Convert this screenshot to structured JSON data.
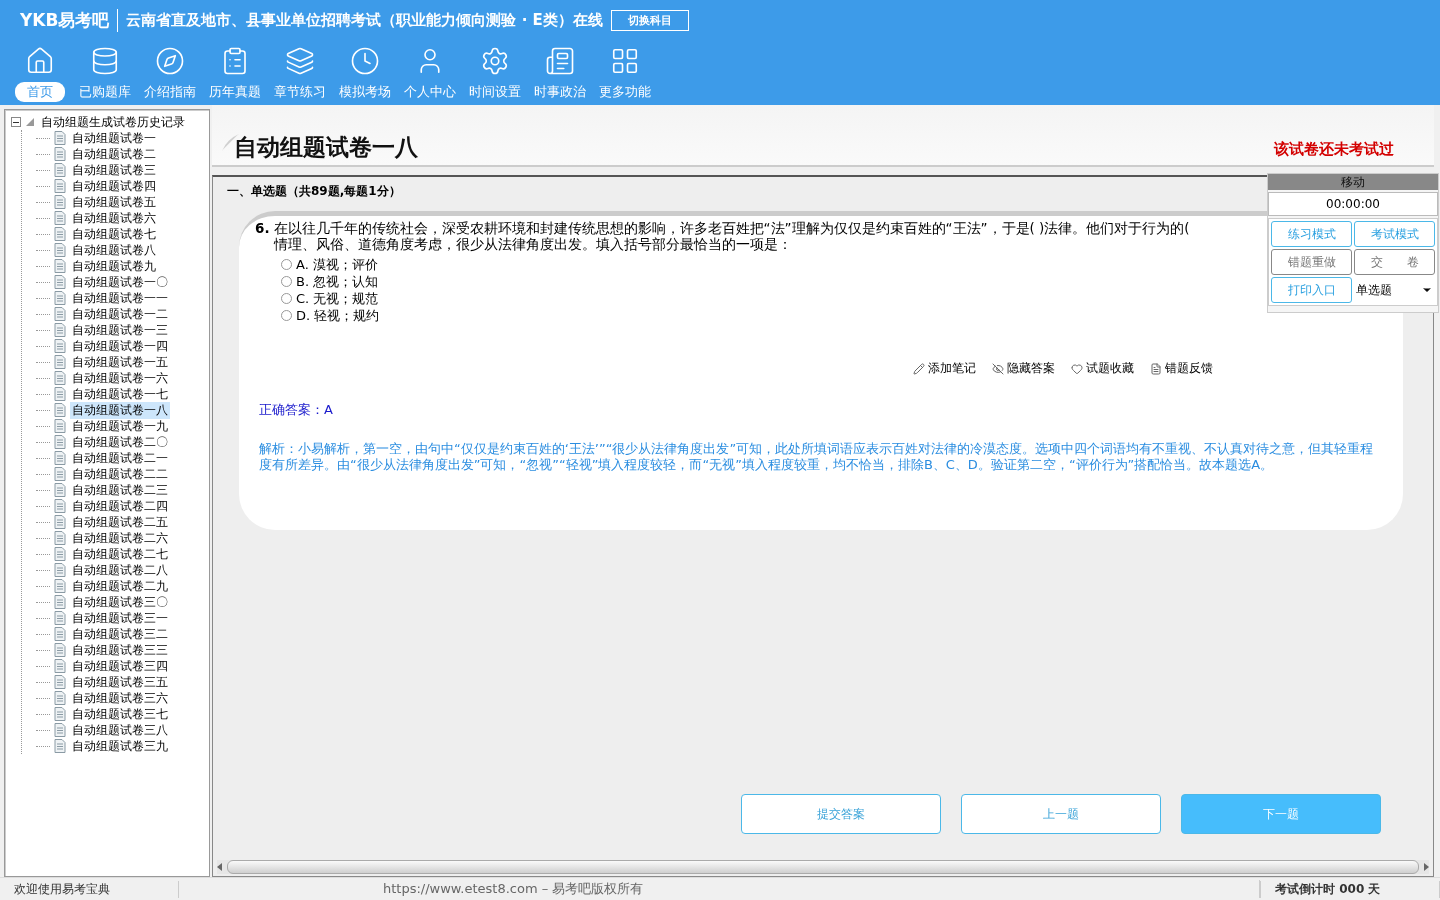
{
  "app": {
    "logo": "YKB易考吧",
    "title": "云南省直及地市、县事业单位招聘考试（职业能力倾向测验 · E类）在线",
    "switch_button": "切换科目"
  },
  "nav": [
    {
      "label": "首页",
      "selected": true
    },
    {
      "label": "已购题库",
      "selected": false
    },
    {
      "label": "介绍指南",
      "selected": false
    },
    {
      "label": "历年真题",
      "selected": false
    },
    {
      "label": "章节练习",
      "selected": false
    },
    {
      "label": "模拟考场",
      "selected": false
    },
    {
      "label": "个人中心",
      "selected": false
    },
    {
      "label": "时间设置",
      "selected": false
    },
    {
      "label": "时事政治",
      "selected": false
    },
    {
      "label": "更多功能",
      "selected": false
    }
  ],
  "tree": {
    "root": "自动组题生成试卷历史记录",
    "expanded": true,
    "children": [
      {
        "label": "自动组题试卷一",
        "selected": false
      },
      {
        "label": "自动组题试卷二",
        "selected": false
      },
      {
        "label": "自动组题试卷三",
        "selected": false
      },
      {
        "label": "自动组题试卷四",
        "selected": false
      },
      {
        "label": "自动组题试卷五",
        "selected": false
      },
      {
        "label": "自动组题试卷六",
        "selected": false
      },
      {
        "label": "自动组题试卷七",
        "selected": false
      },
      {
        "label": "自动组题试卷八",
        "selected": false
      },
      {
        "label": "自动组题试卷九",
        "selected": false
      },
      {
        "label": "自动组题试卷一〇",
        "selected": false
      },
      {
        "label": "自动组题试卷一一",
        "selected": false
      },
      {
        "label": "自动组题试卷一二",
        "selected": false
      },
      {
        "label": "自动组题试卷一三",
        "selected": false
      },
      {
        "label": "自动组题试卷一四",
        "selected": false
      },
      {
        "label": "自动组题试卷一五",
        "selected": false
      },
      {
        "label": "自动组题试卷一六",
        "selected": false
      },
      {
        "label": "自动组题试卷一七",
        "selected": false
      },
      {
        "label": "自动组题试卷一八",
        "selected": true
      },
      {
        "label": "自动组题试卷一九",
        "selected": false
      },
      {
        "label": "自动组题试卷二〇",
        "selected": false
      },
      {
        "label": "自动组题试卷二一",
        "selected": false
      },
      {
        "label": "自动组题试卷二二",
        "selected": false
      },
      {
        "label": "自动组题试卷二三",
        "selected": false
      },
      {
        "label": "自动组题试卷二四",
        "selected": false
      },
      {
        "label": "自动组题试卷二五",
        "selected": false
      },
      {
        "label": "自动组题试卷二六",
        "selected": false
      },
      {
        "label": "自动组题试卷二七",
        "selected": false
      },
      {
        "label": "自动组题试卷二八",
        "selected": false
      },
      {
        "label": "自动组题试卷二九",
        "selected": false
      },
      {
        "label": "自动组题试卷三〇",
        "selected": false
      },
      {
        "label": "自动组题试卷三一",
        "selected": false
      },
      {
        "label": "自动组题试卷三二",
        "selected": false
      },
      {
        "label": "自动组题试卷三三",
        "selected": false
      },
      {
        "label": "自动组题试卷三四",
        "selected": false
      },
      {
        "label": "自动组题试卷三五",
        "selected": false
      },
      {
        "label": "自动组题试卷三六",
        "selected": false
      },
      {
        "label": "自动组题试卷三七",
        "selected": false
      },
      {
        "label": "自动组题试卷三八",
        "selected": false
      },
      {
        "label": "自动组题试卷三九",
        "selected": false
      }
    ]
  },
  "paper": {
    "title": "自动组题试卷一八",
    "status": "该试卷还未考试过"
  },
  "section": "一、单选题（共89题,每题1分）",
  "question": {
    "number": "6.",
    "lines": [
      "在以往几千年的传统社会，深受农耕环境和封建传统思想的影响，许多老百姓把“法”理解为仅仅是约束百姓的“王法”，于是( )法律。他们对于行为的(",
      "情理、风俗、道德角度考虑，很少从法律角度出发。填入括号部分最恰当的一项是："
    ],
    "options": [
      {
        "label": "A.",
        "text": "漠视；评价",
        "selected": false
      },
      {
        "label": "B.",
        "text": "忽视；认知",
        "selected": false
      },
      {
        "label": "C.",
        "text": "无视；规范",
        "selected": false
      },
      {
        "label": "D.",
        "text": "轻视；规约",
        "selected": false
      }
    ]
  },
  "tools": [
    "添加笔记",
    "隐藏答案",
    "试题收藏",
    "错题反馈"
  ],
  "answer": "正确答案：A",
  "explanation": "解析：小易解析，第一空，由句中“仅仅是约束百姓的‘王法’”“很少从法律角度出发”可知，此处所填词语应表示百姓对法律的冷漠态度。选项中四个词语均有不重视、不认真对待之意，但其轻重程度有所差异。由“很少从法律角度出发”可知，“忽视”“轻视”填入程度较轻，而“无视”填入程度较重，均不恰当，排除B、C、D。验证第二空，“评价行为”搭配恰当。故本题选A。",
  "panel": {
    "header": "移动",
    "timer": "00:00:00",
    "buttons": [
      {
        "label": "练习模式",
        "kind": "accent"
      },
      {
        "label": "考试模式",
        "kind": "accent"
      },
      {
        "label": "错题重做",
        "kind": "plain"
      },
      {
        "label": "交　　卷",
        "kind": "plain"
      },
      {
        "label": "打印入口",
        "kind": "accent"
      }
    ],
    "dropdown": "单选题"
  },
  "actions": [
    {
      "label": "提交答案",
      "primary": false
    },
    {
      "label": "上一题",
      "primary": false
    },
    {
      "label": "下一题",
      "primary": true
    }
  ],
  "status_bar": {
    "left": "欢迎使用易考宝典",
    "center": "https://www.etest8.com – 易考吧版权所有",
    "right": "考试倒计时 000 天"
  }
}
